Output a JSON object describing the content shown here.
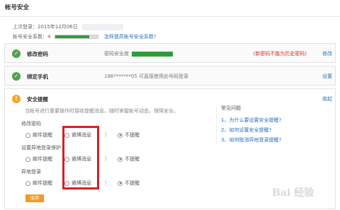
{
  "page": {
    "title": "帐号安全"
  },
  "info": {
    "last_login_label": "上次登录：",
    "last_login_date": "2015年12月06日",
    "score_label": "帐号安全系数：",
    "score_value": "4",
    "score_fraction": 0.8,
    "score_link": "怎样提高帐号安全系数?"
  },
  "password": {
    "title": "修改密码",
    "strength_label": "密码安全度",
    "warning": "(新密码不能为历史密码)",
    "action": "修改"
  },
  "phone": {
    "title": "绑定手机",
    "desc": "186*******05 可直接使用此号码登录",
    "action": "设置"
  },
  "alert": {
    "title": "安全提醒",
    "collapse": "收起",
    "description": "当帐号进行重要操作时接收提醒消息，随时掌握帐号动态，保障安全。",
    "groups": [
      {
        "label": "修改密码",
        "opt_email": "邮件提醒",
        "opt_weibo": "微博消息",
        "opt_none": "不提醒"
      },
      {
        "label": "设置异地登录保护",
        "opt_email": "邮件提醒",
        "opt_weibo": "微博消息",
        "opt_none": "不提醒"
      },
      {
        "label": "异地登录",
        "opt_email": "邮件提醒",
        "opt_weibo": "微博消息",
        "opt_none": "不提醒"
      }
    ],
    "separator": "|",
    "save": "保存"
  },
  "faq": {
    "title": "常见问题",
    "items": [
      "1、为什么要设置安全提醒?",
      "2、如何设置安全提醒?",
      "3、如何取消异地登录提醒?"
    ]
  },
  "watermark": "Bai 经验",
  "colors": {
    "accent_link": "#2a6fbd",
    "success": "#2e9e3a",
    "warning": "#d9302c",
    "highlight": "#d62027",
    "button": "#f39a23"
  }
}
